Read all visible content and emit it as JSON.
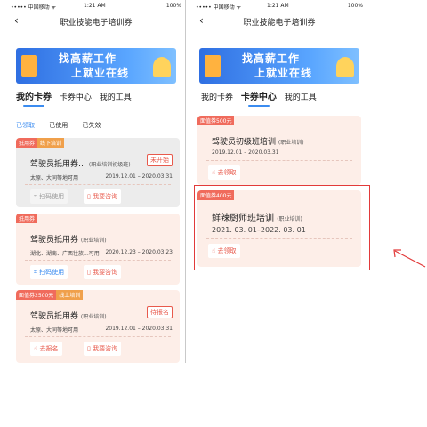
{
  "status_left": {
    "carrier": "••••• 中国移动 ᯤ",
    "time": "1:21 AM",
    "battery": "100%"
  },
  "status_right": {
    "carrier": "••••• 中国移动 ᯤ",
    "time": "1:21 AM",
    "battery": "100%"
  },
  "nav": {
    "back": "‹",
    "title": "职业技能电子培训券"
  },
  "banner": {
    "line1": "找高薪工作",
    "line2": "上就业在线"
  },
  "tabs": [
    "我的卡券",
    "卡券中心",
    "我的工具"
  ],
  "filters": [
    "已领取",
    "已使用",
    "已失效"
  ],
  "left_cards": [
    {
      "tags": [
        "抵用券",
        "线下培训"
      ],
      "name": "驾驶员抵用券…",
      "sub": "(职业培训初级班)",
      "location": "太原、大同等地可用",
      "date": "2019.12.01 – 2020.03.31",
      "badge": "未开始",
      "btn1": "扫码使用",
      "btn2": "我要咨询"
    },
    {
      "tags": [
        "抵用券"
      ],
      "name": "驾驶员抵用券",
      "sub": "(职业培训)",
      "location": "湖北、湖南、广西壮族...可用",
      "date": "2020.12.23 – 2020.03.23",
      "btn1": "扫码使用",
      "btn2": "我要咨询"
    },
    {
      "tags": [
        "面值券2500元",
        "线上培训"
      ],
      "name": "驾驶员抵用券",
      "sub": "(职业培训)",
      "location": "太原、大同等地可用",
      "date": "2019.12.01 – 2020.03.31",
      "badge": "待报名",
      "btn1": "去报名",
      "btn2": "我要咨询"
    }
  ],
  "right_cards": [
    {
      "tags": [
        "面值券500元"
      ],
      "name": "驾驶员初级班培训",
      "sub": "(职业培训)",
      "date": "2019.12.01 – 2020.03.31",
      "btn1": "去领取"
    },
    {
      "tags": [
        "面值券400元"
      ],
      "name": "鲜辣厨师班培训",
      "sub": "(职业培训)",
      "date": "2021. 03. 01–2022. 03. 01",
      "btn1": "去领取"
    }
  ],
  "colors": {
    "accent": "#3b8cf0",
    "tag": "#f06b5c",
    "highlight": "#e23a3a"
  }
}
